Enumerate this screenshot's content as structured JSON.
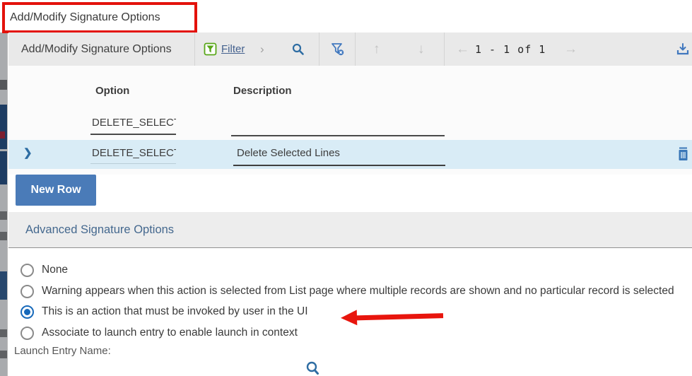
{
  "annotation": {
    "boxed_title": "Add/Modify Signature Options"
  },
  "toolbar": {
    "title": "Add/Modify Signature Options",
    "filter_label": "Filter",
    "pagination": "1 - 1 of 1",
    "up_arrow": "↑",
    "down_arrow": "↓",
    "left_arrow": "←",
    "right_arrow": "→",
    "expand_chevron": "›"
  },
  "table": {
    "columns": {
      "option": "Option",
      "description": "Description"
    },
    "filter_row": {
      "option": "DELETE_SELECT",
      "description": ""
    },
    "row": {
      "option": "DELETE_SELECT",
      "description": "Delete Selected Lines",
      "expander": "❯"
    }
  },
  "actions": {
    "new_row": "New Row"
  },
  "advanced": {
    "header": "Advanced Signature Options",
    "options": [
      {
        "label": "None",
        "selected": false
      },
      {
        "label": "Warning appears when this action is selected from List page where multiple records are shown and no particular record is selected",
        "selected": false
      },
      {
        "label": "This is an action that must be invoked by user in the UI",
        "selected": true
      },
      {
        "label": "Associate to launch entry to enable launch in context",
        "selected": false
      }
    ],
    "launch_entry_label": "Launch Entry Name:"
  },
  "colors": {
    "accent_blue": "#2e6da3",
    "button_blue": "#4a7bb8",
    "selected_row_blue": "#d9ecf6",
    "annotation_red": "#e8150d",
    "filter_icon_green": "#58a618",
    "section_header_text": "#44688e",
    "toolbar_gray": "#e9e9e9"
  }
}
